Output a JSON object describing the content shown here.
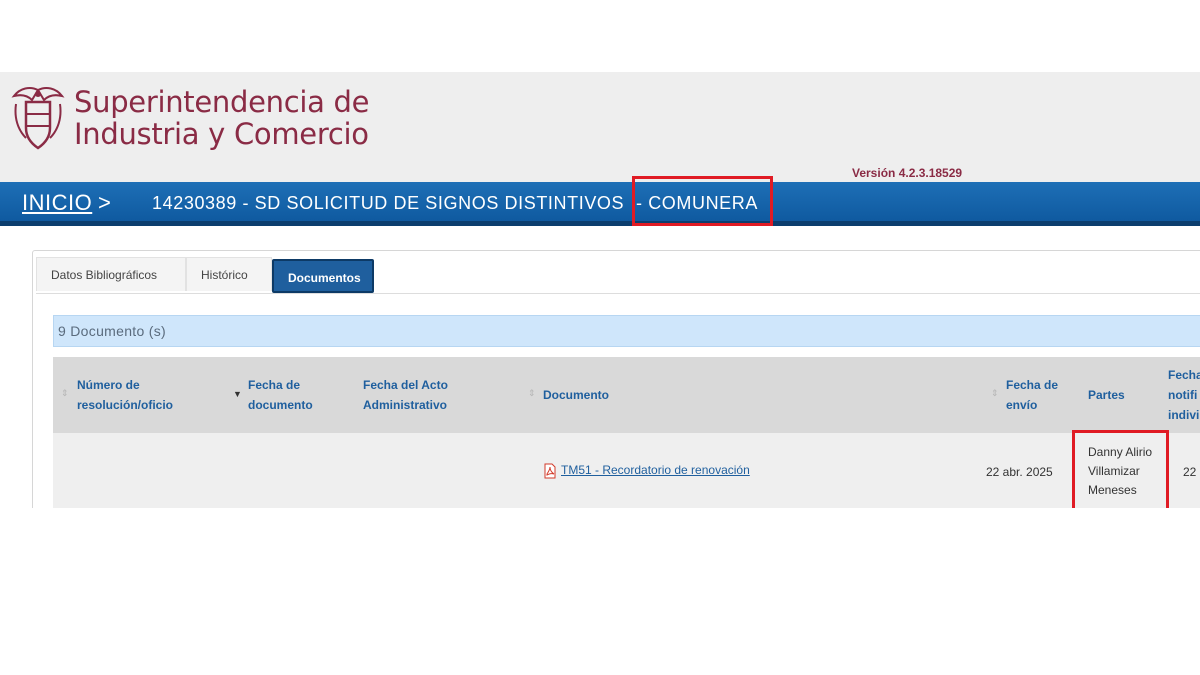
{
  "header": {
    "org_line1": "Superintendencia de",
    "org_line2": "Industria y Comercio",
    "version": "Versión 4.2.3.18529"
  },
  "nav": {
    "home": "INICIO",
    "separator": ">",
    "crumb": "14230389 - SD SOLICITUD DE SIGNOS DISTINTIVOS",
    "crumb_suffix": "- COMUNERA"
  },
  "tabs": [
    {
      "label": "Datos Bibliográficos",
      "active": false
    },
    {
      "label": "Histórico",
      "active": false
    },
    {
      "label": "Documentos",
      "active": true
    }
  ],
  "documents": {
    "count_label": "9 Documento (s)",
    "columns": {
      "resolucion": [
        "Número de",
        "resolución/oficio"
      ],
      "fecha_documento": [
        "Fecha de",
        "documento"
      ],
      "fecha_acto": [
        "Fecha del Acto",
        "Administrativo"
      ],
      "documento": "Documento",
      "fecha_envio": [
        "Fecha de",
        "envío"
      ],
      "partes": "Partes",
      "fecha_notificacion": [
        "Fecha",
        "notifi",
        "indivi"
      ]
    },
    "rows": [
      {
        "resolucion": "",
        "fecha_documento": "",
        "fecha_acto": "",
        "documento": "TM51 - Recordatorio de renovación",
        "fecha_envio": "22 abr. 2025",
        "partes": [
          "Danny Alirio",
          "Villamizar",
          "Meneses"
        ],
        "fecha_notificacion": "22"
      }
    ]
  },
  "colors": {
    "brand": "#8a2b45",
    "nav_blue": "#1565b0",
    "highlight": "#e01b24",
    "link": "#1f5f9e"
  },
  "icons": [
    "coat-of-arms-logo",
    "pdf-icon",
    "sort-icon",
    "sort-desc-icon"
  ]
}
